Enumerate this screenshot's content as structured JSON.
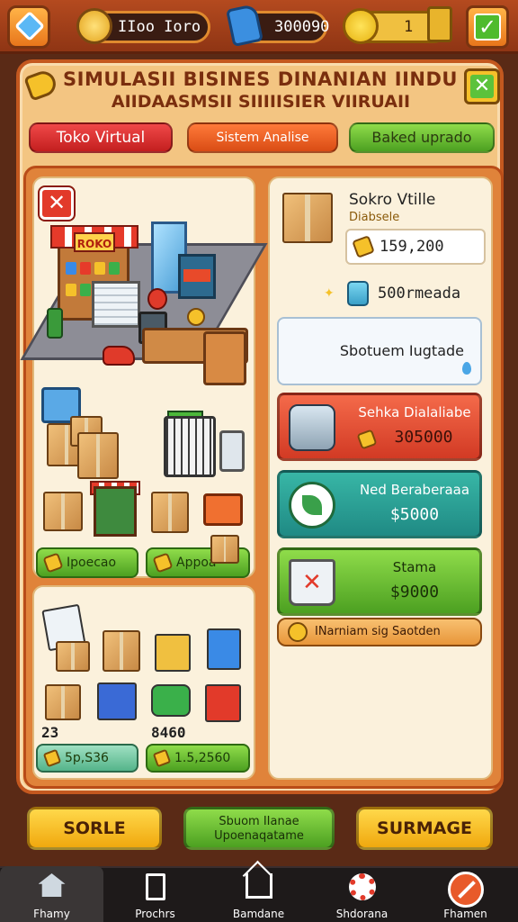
{
  "topbar": {
    "resource1_value": "IIoo Ioro",
    "resource2_value": "300090",
    "resource3_value": "1"
  },
  "header": {
    "title_line1": "SIMULASII BISINES DINANIAN IINDUNSIA",
    "title_line2": "AIIDAASMSII SIIIIISIER VIIRUAII"
  },
  "tabs": [
    {
      "label": "Toko Virtual"
    },
    {
      "label": "Sistem Analise"
    },
    {
      "label": "Baked uprado"
    }
  ],
  "store_panel": {
    "sign_text": "ROKO",
    "button_left": "Ipoecao",
    "button_right": "Appoa"
  },
  "inventory_panel": {
    "count_left": "23",
    "count_right": "8460",
    "price_left": "5p,S36",
    "price_right": "1.5,2560"
  },
  "product": {
    "name": "Sokro Vtille",
    "subtitle": "Diabsele",
    "price": "159,200",
    "currency_amount": "500rmeada",
    "upgrade_label": "Sbotuem Iugtade"
  },
  "actions": [
    {
      "title": "Sehka Dialaliabe",
      "price": "305000"
    },
    {
      "title": "Ned Beraberaaa",
      "price": "$5000"
    },
    {
      "title": "Stama",
      "price": "$9000"
    }
  ],
  "notice": "INarniam sig Saotden",
  "bottom_buttons": {
    "left": "SORLE",
    "middle_line1": "Sbuom IIanae",
    "middle_line2": "Upoenaqatame",
    "right": "SURMAGE"
  },
  "nav": [
    {
      "label": "Fhamy",
      "icon": "home-icon"
    },
    {
      "label": "Prochrs",
      "icon": "document-icon"
    },
    {
      "label": "Bamdane",
      "icon": "house-outline-icon"
    },
    {
      "label": "Shdorana",
      "icon": "gear-icon"
    },
    {
      "label": "Fhamen",
      "icon": "ban-icon"
    }
  ],
  "colors": {
    "primary_orange": "#e0833a",
    "panel_cream": "#fbf1dc",
    "accent_green": "#4ca021",
    "accent_red": "#d23a24",
    "accent_teal": "#1f8a84"
  }
}
